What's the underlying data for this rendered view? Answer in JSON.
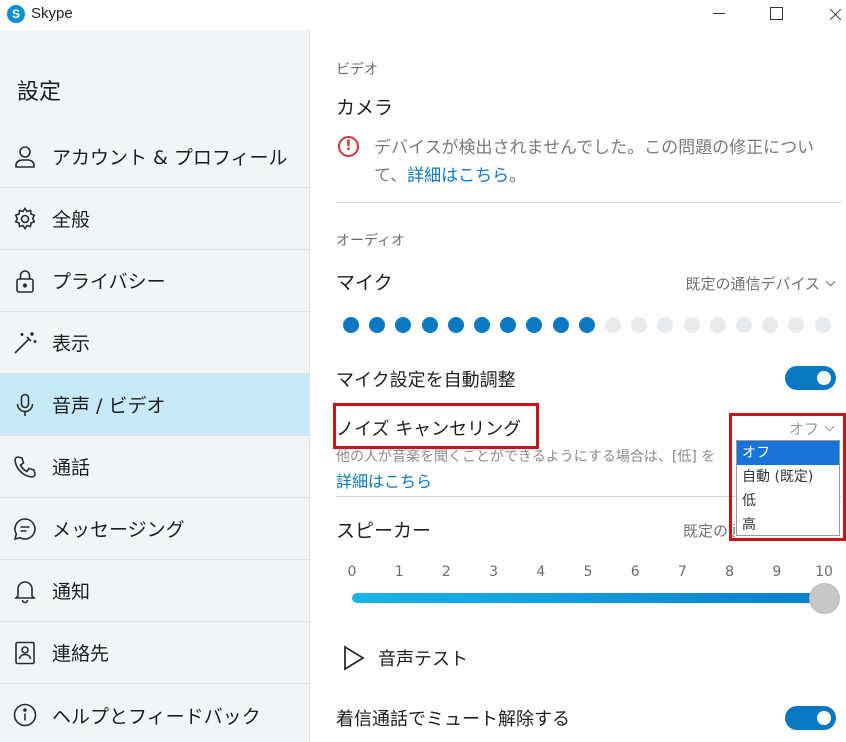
{
  "window": {
    "title": "Skype",
    "logo_letter": "S"
  },
  "sidebar": {
    "title": "設定",
    "items": [
      {
        "label": "アカウント & プロフィール",
        "icon": "person-icon"
      },
      {
        "label": "全般",
        "icon": "gear-icon"
      },
      {
        "label": "プライバシー",
        "icon": "lock-icon"
      },
      {
        "label": "表示",
        "icon": "magic-wand-icon"
      },
      {
        "label": "音声 / ビデオ",
        "icon": "microphone-icon",
        "active": true
      },
      {
        "label": "通話",
        "icon": "phone-icon"
      },
      {
        "label": "メッセージング",
        "icon": "chat-bubble-icon"
      },
      {
        "label": "通知",
        "icon": "bell-icon"
      },
      {
        "label": "連絡先",
        "icon": "contact-card-icon"
      },
      {
        "label": "ヘルプとフィードバック",
        "icon": "info-icon"
      }
    ]
  },
  "video": {
    "section_label": "ビデオ",
    "camera_heading": "カメラ",
    "warning_icon": "!",
    "warning_text": "デバイスが検出されませんでした。この問題の修正について、",
    "warning_link": "詳細はこちら",
    "warning_end": "。"
  },
  "audio": {
    "section_label": "オーディオ",
    "mic_heading": "マイク",
    "mic_device": "既定の通信デバイス",
    "mic_level_active": 10,
    "mic_level_total": 19,
    "auto_adjust_label": "マイク設定を自動調整",
    "auto_adjust_on": true,
    "noise_heading": "ノイズ キャンセリング",
    "noise_value": "オフ",
    "noise_desc": "他の人が音楽を聞くことができるようにする場合は、[低] を",
    "noise_link": "詳細はこちら",
    "noise_options": [
      "オフ",
      "自動 (既定)",
      "低",
      "高"
    ],
    "noise_selected": 0,
    "speaker_heading": "スピーカー",
    "speaker_device": "既定の通信デバイス",
    "speaker_ticks": [
      "0",
      "1",
      "2",
      "3",
      "4",
      "5",
      "6",
      "7",
      "8",
      "9",
      "10"
    ],
    "speaker_volume": 10,
    "sound_test_label": "音声テスト",
    "unmute_label": "着信通話でミュート解除する",
    "unmute_on": true
  },
  "colors": {
    "accent": "#0a78c2",
    "active_sidebar": "#c7e8f8",
    "highlight_red": "#d10f1b",
    "dropdown_selected": "#1874d9",
    "meter_active": "#0a78c2",
    "meter_inactive": "#e8ebee"
  }
}
